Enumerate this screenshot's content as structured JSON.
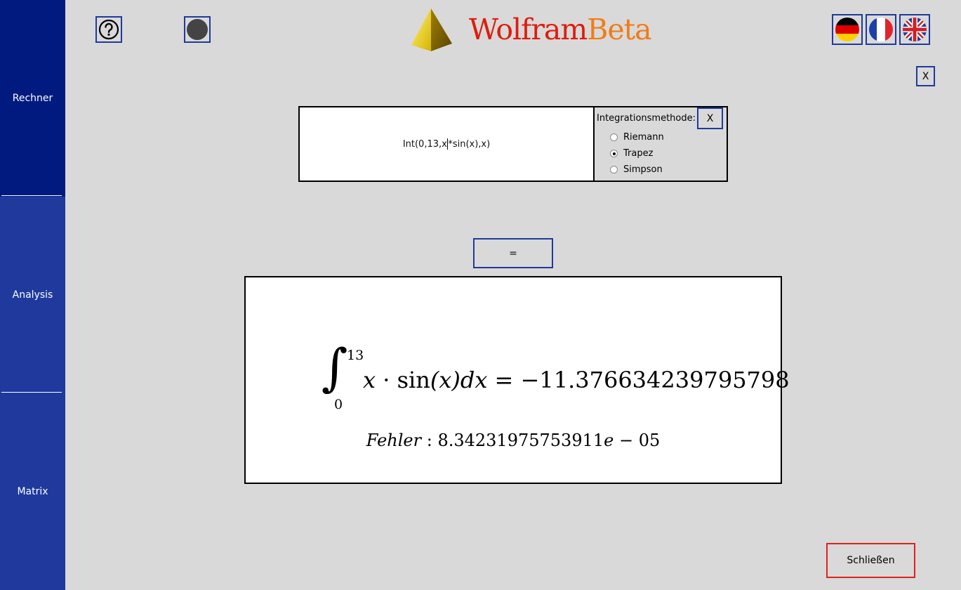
{
  "app": {
    "title_part1": "Wolfram",
    "title_part2": "Beta",
    "title_color1": "#e01c0c",
    "title_color2": "#f07c18"
  },
  "sidebar": {
    "items": [
      {
        "label": "Rechner",
        "active": true
      },
      {
        "label": "Analysis",
        "active": false
      },
      {
        "label": "Matrix",
        "active": false
      }
    ],
    "color": "#1f3a9c",
    "active_color": "#001a80"
  },
  "toolbar": {
    "help_icon": "question-circle-icon",
    "theme_icon": "dark-circle-icon",
    "languages": [
      {
        "icon": "german-flag-icon"
      },
      {
        "icon": "french-flag-icon"
      },
      {
        "icon": "uk-flag-icon"
      }
    ],
    "close_panel_label": "X"
  },
  "calculator": {
    "input_before_caret": "Int(0,13,x",
    "input_after_caret": "*sin(x),x)",
    "method_label": "Integrationsmethode:",
    "method_close_label": "X",
    "methods": [
      {
        "label": "Riemann",
        "selected": false
      },
      {
        "label": "Trapez",
        "selected": true
      },
      {
        "label": "Simpson",
        "selected": false
      }
    ],
    "equals_label": "="
  },
  "result": {
    "integral_symbol": "∫",
    "lower": "0",
    "upper": "13",
    "integrand_var": "x",
    "dot": " · ",
    "func": "sin",
    "arg": "(x)",
    "dx": "dx",
    "equals": " = ",
    "value": "−11.376634239795798",
    "error_label": "Fehler",
    "error_sep": " : ",
    "error_mantissa": "8.34231975753911",
    "error_e": "e",
    "error_exp": " − 05"
  },
  "footer": {
    "close_label": "Schließen",
    "close_border_color": "#e0201a"
  }
}
